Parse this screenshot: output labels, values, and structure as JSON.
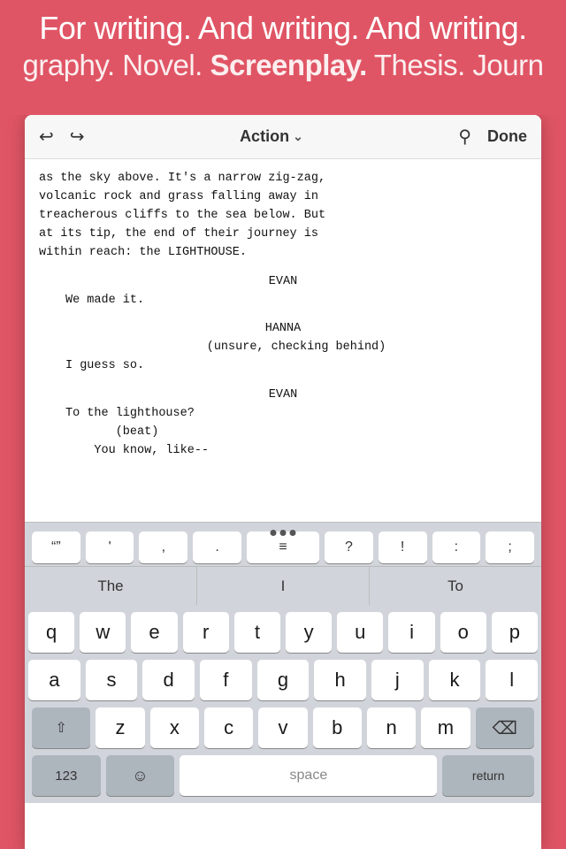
{
  "marketing": {
    "line1": "For writing. And writing. And writing.",
    "line2_before": "graphy. Novel. ",
    "line2_highlight": "Screenplay.",
    "line2_after": " Thesis. Journ"
  },
  "toolbar": {
    "undo_icon": "↩",
    "redo_icon": "↪",
    "action_label": "Action",
    "chevron": "∨",
    "search_icon": "🔍",
    "done_label": "Done"
  },
  "screenplay": {
    "action_text": "as the sky above. It's a narrow zig-zag,\nvolcanic rock and grass falling away in\ntreacherous cliffs to the sea below. But\nat its tip, the end of their journey is\nwithin reach: the LIGHTHOUSE.",
    "dialogue": [
      {
        "character": "EVAN",
        "parenthetical": null,
        "text": "We made it."
      },
      {
        "character": "HANNA",
        "parenthetical": "(unsure, checking behind)",
        "text": "I guess so."
      },
      {
        "character": "EVAN",
        "parenthetical": null,
        "text": "To the lighthouse?\n        (beat)\n    You know, like--"
      }
    ]
  },
  "accessory": {
    "keys": [
      "\"\"",
      "'",
      ",",
      ".",
      "≡",
      "?",
      "!",
      ":",
      ";"
    ]
  },
  "predictive": {
    "items": [
      "The",
      "I",
      "To"
    ]
  },
  "keyboard": {
    "rows": [
      [
        "q",
        "w",
        "e",
        "r",
        "t",
        "y",
        "u",
        "i",
        "o",
        "p"
      ],
      [
        "a",
        "s",
        "d",
        "f",
        "g",
        "h",
        "j",
        "k",
        "l"
      ],
      [
        "z",
        "x",
        "c",
        "v",
        "b",
        "n",
        "m"
      ]
    ],
    "space_label": "space"
  }
}
